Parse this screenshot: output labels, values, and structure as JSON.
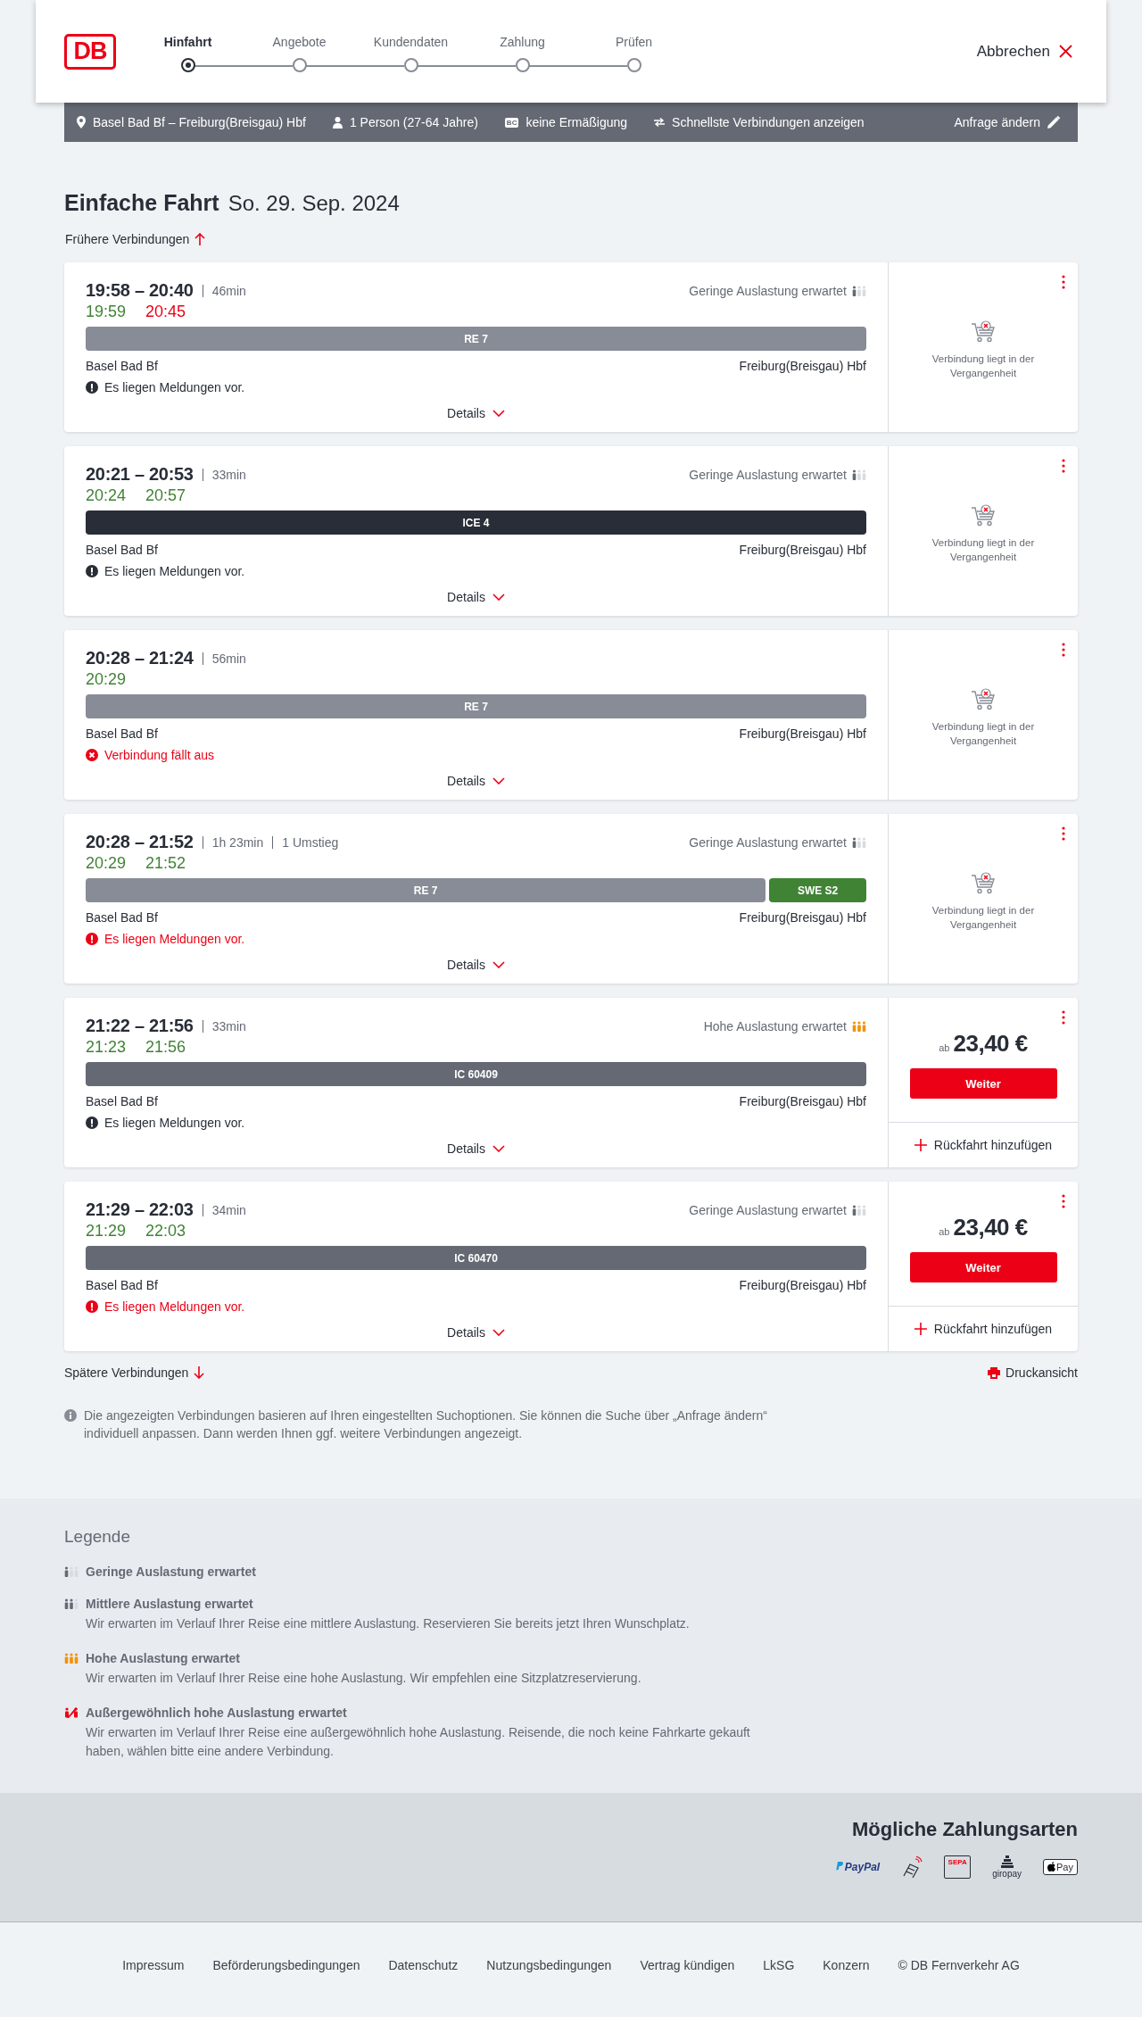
{
  "header": {
    "logo": "DB",
    "steps": [
      {
        "label": "Hinfahrt",
        "selected": true
      },
      {
        "label": "Angebote",
        "selected": false
      },
      {
        "label": "Kundendaten",
        "selected": false
      },
      {
        "label": "Zahlung",
        "selected": false
      },
      {
        "label": "Prüfen",
        "selected": false
      }
    ],
    "cancel": "Abbrechen"
  },
  "request_bar": {
    "items": [
      {
        "kind": "route",
        "text": "Basel Bad Bf – Freiburg(Breisgau) Hbf"
      },
      {
        "kind": "person",
        "text": "1 Person (27-64 Jahre)"
      },
      {
        "kind": "discount",
        "badge": "BC",
        "text": "keine Ermäßigung"
      },
      {
        "kind": "options",
        "text": "Schnellste Verbindungen anzeigen"
      }
    ],
    "edit": "Anfrage ändern"
  },
  "title": {
    "trip": "Einfache Fahrt",
    "date": "So. 29. Sep. 2024"
  },
  "earlier": "Frühere Verbindungen",
  "connections": [
    {
      "time": "19:58 – 20:40",
      "infos": [
        "46min"
      ],
      "occupancy": {
        "kind": "low",
        "text": "Geringe Auslastung erwartet"
      },
      "realtime": [
        {
          "text": "19:59",
          "delayed": false
        },
        {
          "text": "20:45",
          "delayed": true
        }
      ],
      "segments": [
        {
          "label": "RE 7",
          "kind": "regional"
        }
      ],
      "from": "Basel Bad Bf",
      "to": "Freiburg(Breisgau) Hbf",
      "message": {
        "kind": "info",
        "text": "Es liegen Meldungen vor."
      },
      "details": "Details",
      "offer": {
        "kind": "past",
        "text": "Verbindung liegt in der Vergangenheit"
      }
    },
    {
      "time": "20:21 – 20:53",
      "infos": [
        "33min"
      ],
      "occupancy": {
        "kind": "low",
        "text": "Geringe Auslastung erwartet"
      },
      "realtime": [
        {
          "text": "20:24",
          "delayed": false
        },
        {
          "text": "20:57",
          "delayed": false
        }
      ],
      "segments": [
        {
          "label": "ICE 4",
          "kind": "ice"
        }
      ],
      "from": "Basel Bad Bf",
      "to": "Freiburg(Breisgau) Hbf",
      "message": {
        "kind": "info",
        "text": "Es liegen Meldungen vor."
      },
      "details": "Details",
      "offer": {
        "kind": "past",
        "text": "Verbindung liegt in der Vergangenheit"
      }
    },
    {
      "time": "20:28 – 21:24",
      "infos": [
        "56min"
      ],
      "realtime": [
        {
          "text": "20:29",
          "delayed": false
        }
      ],
      "segments": [
        {
          "label": "RE 7",
          "kind": "regional"
        }
      ],
      "from": "Basel Bad Bf",
      "to": "Freiburg(Breisgau) Hbf",
      "message": {
        "kind": "cancelled",
        "text": "Verbindung fällt aus"
      },
      "details": "Details",
      "offer": {
        "kind": "past",
        "text": "Verbindung liegt in der Vergangenheit"
      }
    },
    {
      "time": "20:28 – 21:52",
      "infos": [
        "1h 23min",
        "1 Umstieg"
      ],
      "occupancy": {
        "kind": "low",
        "text": "Geringe Auslastung erwartet"
      },
      "realtime": [
        {
          "text": "20:29",
          "delayed": false
        },
        {
          "text": "21:52",
          "delayed": false
        }
      ],
      "segments": [
        {
          "label": "RE 7",
          "kind": "regional"
        },
        {
          "label": "SWE S2",
          "kind": "sbahn"
        }
      ],
      "from": "Basel Bad Bf",
      "to": "Freiburg(Breisgau) Hbf",
      "message": {
        "kind": "warning",
        "text": "Es liegen Meldungen vor."
      },
      "details": "Details",
      "offer": {
        "kind": "past",
        "text": "Verbindung liegt in der Vergangenheit"
      }
    },
    {
      "time": "21:22 – 21:56",
      "infos": [
        "33min"
      ],
      "occupancy": {
        "kind": "high",
        "text": "Hohe Auslastung erwartet"
      },
      "realtime": [
        {
          "text": "21:23",
          "delayed": false
        },
        {
          "text": "21:56",
          "delayed": false
        }
      ],
      "segments": [
        {
          "label": "IC 60409",
          "kind": "ic"
        }
      ],
      "from": "Basel Bad Bf",
      "to": "Freiburg(Breisgau) Hbf",
      "message": {
        "kind": "info",
        "text": "Es liegen Meldungen vor."
      },
      "details": "Details",
      "offer": {
        "kind": "price",
        "prefix": "ab",
        "price": "23,40 €",
        "button": "Weiter",
        "return": "Rückfahrt hinzufügen"
      }
    },
    {
      "time": "21:29 – 22:03",
      "infos": [
        "34min"
      ],
      "occupancy": {
        "kind": "low",
        "text": "Geringe Auslastung erwartet"
      },
      "realtime": [
        {
          "text": "21:29",
          "delayed": false
        },
        {
          "text": "22:03",
          "delayed": false
        }
      ],
      "segments": [
        {
          "label": "IC 60470",
          "kind": "ic"
        }
      ],
      "from": "Basel Bad Bf",
      "to": "Freiburg(Breisgau) Hbf",
      "message": {
        "kind": "warning",
        "text": "Es liegen Meldungen vor."
      },
      "details": "Details",
      "offer": {
        "kind": "price",
        "prefix": "ab",
        "price": "23,40 €",
        "button": "Weiter",
        "return": "Rückfahrt hinzufügen"
      }
    }
  ],
  "later": "Spätere Verbindungen",
  "print": "Druckansicht",
  "notice": "Die angezeigten Verbindungen basieren auf Ihren eingestellten Suchoptionen. Sie können die Suche über „Anfrage ändern“ individuell anpassen. Dann werden Ihnen ggf. weitere Verbindungen angezeigt.",
  "legend": {
    "title": "Legende",
    "items": [
      {
        "kind": "low",
        "title": "Geringe Auslastung erwartet"
      },
      {
        "kind": "medium",
        "title": "Mittlere Auslastung erwartet",
        "text": "Wir erwarten im Verlauf Ihrer Reise eine mittlere Auslastung. Reservieren Sie bereits jetzt Ihren Wunschplatz."
      },
      {
        "kind": "high",
        "title": "Hohe Auslastung erwartet",
        "text": "Wir erwarten im Verlauf Ihrer Reise eine hohe Auslastung. Wir empfehlen eine Sitzplatzreservierung."
      },
      {
        "kind": "extreme",
        "title": "Außergewöhnlich hohe Auslastung erwartet",
        "text": "Wir erwarten im Verlauf Ihrer Reise eine außergewöhnlich hohe Auslastung. Reisende, die noch keine Fahrkarte gekauft haben, wählen bitte eine andere Verbindung."
      }
    ]
  },
  "payment": {
    "title": "Mögliche Zahlungsarten",
    "methods": [
      {
        "kind": "paypal",
        "label": "PayPal"
      },
      {
        "kind": "card"
      },
      {
        "kind": "sepa",
        "label": "SEPA"
      },
      {
        "kind": "giropay",
        "label": "giropay"
      },
      {
        "kind": "applepay",
        "label": "Pay"
      }
    ]
  },
  "footer": {
    "links": [
      "Impressum",
      "Beförderungsbedingungen",
      "Datenschutz",
      "Nutzungsbedingungen",
      "Vertrag kündigen",
      "LkSG",
      "Konzern",
      "© DB Fernverkehr AG"
    ]
  }
}
